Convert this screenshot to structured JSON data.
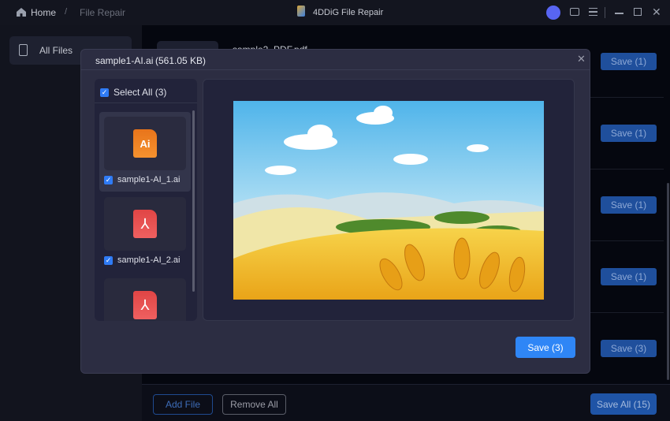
{
  "titlebar": {
    "home": "Home",
    "separator": "/",
    "crumb": "File Repair",
    "app_title": "4DDiG File Repair"
  },
  "sidebar": {
    "items": [
      {
        "label": "All Files"
      }
    ]
  },
  "main": {
    "first_file_name": "sample2_PDF.pdf",
    "save_buttons": [
      "Save (1)",
      "Save (1)",
      "Save (1)",
      "Save (1)",
      "Save (3)"
    ]
  },
  "bottom": {
    "add_file": "Add File",
    "remove_all": "Remove All",
    "save_all": "Save All (15)"
  },
  "modal": {
    "title": "sample1-AI.ai",
    "size": "(561.05 KB)",
    "select_all": "Select All (3)",
    "files": [
      {
        "name": "sample1-AI_1.ai",
        "type": "Ai",
        "checked": true
      },
      {
        "name": "sample1-AI_2.ai",
        "type": "pdf",
        "checked": true
      },
      {
        "name": "",
        "type": "pdf",
        "checked": true
      }
    ],
    "save": "Save (3)",
    "check_mark": "✓",
    "close": "✕"
  }
}
